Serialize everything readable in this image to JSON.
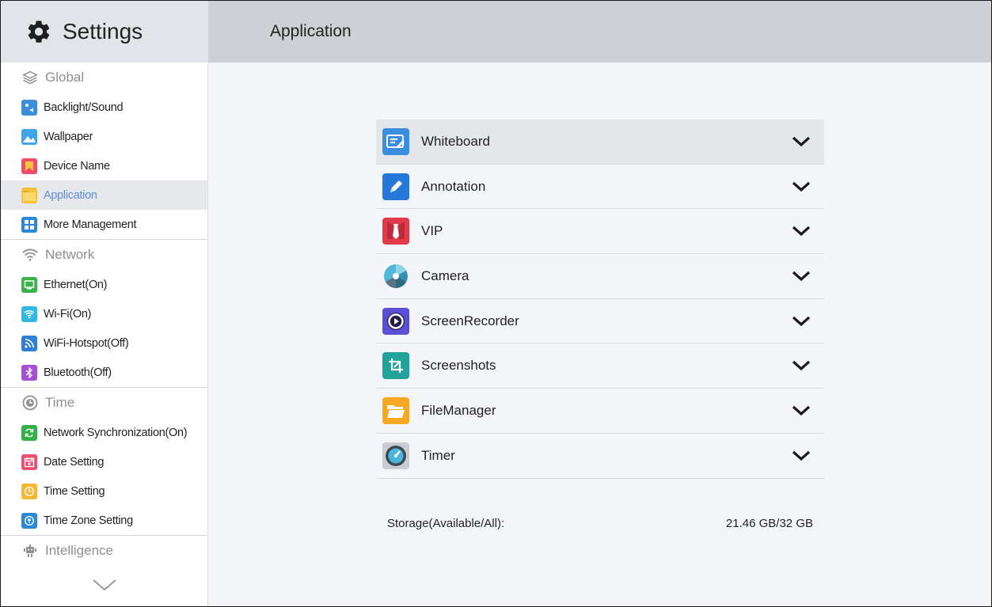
{
  "header": {
    "app_title": "Settings",
    "page_title": "Application"
  },
  "sidebar": {
    "sections": [
      {
        "title": "Global",
        "icon": "layers-icon",
        "items": [
          {
            "label": "Backlight/Sound",
            "icon": "backlight-icon",
            "color": "#3d8fd9"
          },
          {
            "label": "Wallpaper",
            "icon": "wallpaper-icon",
            "color": "#3fa4e8"
          },
          {
            "label": "Device Name",
            "icon": "bookmark-icon",
            "color": "#ec4f6e"
          },
          {
            "label": "Application",
            "icon": "folder-icon",
            "color": "#f7c23b",
            "active": true
          },
          {
            "label": "More Management",
            "icon": "grid-icon",
            "color": "#2a86d6"
          }
        ]
      },
      {
        "title": "Network",
        "icon": "wifi-icon",
        "items": [
          {
            "label": "Ethernet(On)",
            "icon": "ethernet-icon",
            "color": "#3ab24a"
          },
          {
            "label": "Wi-Fi(On)",
            "icon": "wifi-icon",
            "color": "#33b8e6"
          },
          {
            "label": "WiFi-Hotspot(Off)",
            "icon": "hotspot-icon",
            "color": "#2f7fd8"
          },
          {
            "label": "Bluetooth(Off)",
            "icon": "bluetooth-icon",
            "color": "#a44fd6"
          }
        ]
      },
      {
        "title": "Time",
        "icon": "clock-icon",
        "items": [
          {
            "label": "Network Synchronization(On)",
            "icon": "sync-icon",
            "color": "#34b04a"
          },
          {
            "label": "Date Setting",
            "icon": "calendar-icon",
            "color": "#ec4f6e"
          },
          {
            "label": "Time Setting",
            "icon": "clock-icon",
            "color": "#f7b733"
          },
          {
            "label": "Time Zone Setting",
            "icon": "location-icon",
            "color": "#2a8ad6"
          }
        ]
      },
      {
        "title": "Intelligence",
        "icon": "robot-icon",
        "items": []
      }
    ]
  },
  "apps": [
    {
      "name": "Whiteboard",
      "icon": "whiteboard-icon",
      "color": "#3a8ee0"
    },
    {
      "name": "Annotation",
      "icon": "pen-icon",
      "color": "#2678d8"
    },
    {
      "name": "VIP",
      "icon": "tie-icon",
      "color": "#e23a4b"
    },
    {
      "name": "Camera",
      "icon": "aperture-icon",
      "color": "#4fb7d9"
    },
    {
      "name": "ScreenRecorder",
      "icon": "record-icon",
      "color": "#5b4fd8"
    },
    {
      "name": "Screenshots",
      "icon": "crop-icon",
      "color": "#21a39b"
    },
    {
      "name": "FileManager",
      "icon": "folder-open-icon",
      "color": "#f7a823"
    },
    {
      "name": "Timer",
      "icon": "timer-icon",
      "color": "#4a5560"
    }
  ],
  "storage": {
    "label": "Storage(Available/All):",
    "value": "21.46 GB/32 GB"
  }
}
